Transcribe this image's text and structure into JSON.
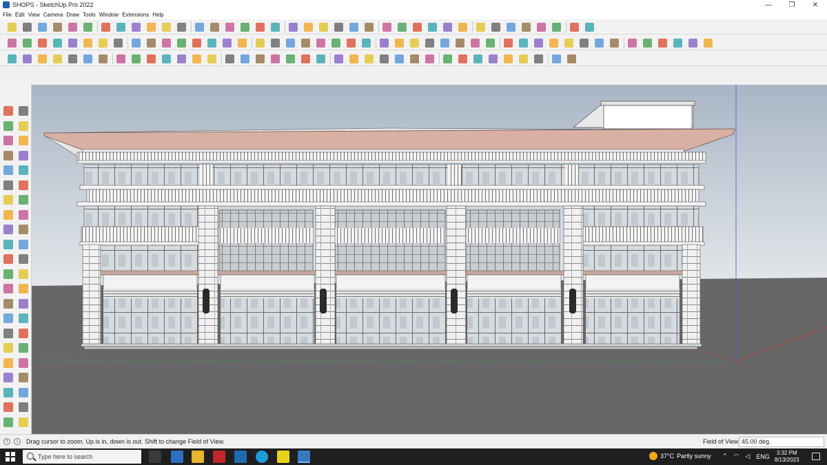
{
  "window": {
    "title": "SHOPS - SketchUp Pro 2022",
    "minimize": "—",
    "maximize": "❐",
    "close": "✕"
  },
  "menu": [
    "File",
    "Edit",
    "View",
    "Camera",
    "Draw",
    "Tools",
    "Window",
    "Extensions",
    "Help"
  ],
  "status": {
    "message": "Drag cursor to zoom.  Up is in, down is out. Shift to change Field of View.",
    "measure_label": "Field of View",
    "measure_value": "45.00 deg."
  },
  "taskbar": {
    "search_placeholder": "Type here to search",
    "weather_temp": "37°C",
    "weather_text": "Partly sunny",
    "language": "ENG",
    "time": "3:32 PM",
    "date": "8/13/2023"
  },
  "colors": {
    "sky_top": "#a9b6c6",
    "sky_bottom": "#e4e7ea",
    "ground": "#676767",
    "roof": "#d8b0a4",
    "accent_axis_green": "#3a9a3a",
    "accent_axis_red": "#c23a3a",
    "accent_axis_blue": "#3a5ad8"
  },
  "icons": {
    "app": "sketchup-icon",
    "start": "windows-start-icon",
    "search": "search-icon",
    "weather": "partly-sunny-icon"
  }
}
